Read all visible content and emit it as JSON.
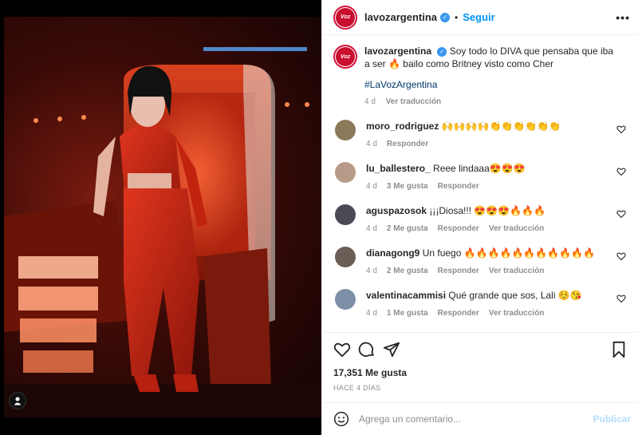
{
  "post": {
    "username": "lavozargentina",
    "avatar_text": "Voz",
    "follow_label": "Seguir",
    "more_label": "•••",
    "caption_text": "Soy todo lo DIVA que pensaba que iba a ser 🔥 bailo como Britney visto como Cher",
    "hashtag": "#LaVozArgentina",
    "caption_time": "4 d",
    "caption_translate": "Ver traducción",
    "likes": "17,351 Me gusta",
    "time_ago": "HACE 4 DÍAS"
  },
  "comments": [
    {
      "user": "moro_rodriguez",
      "text": "🙌🙌🙌🙌👏👏👏👏👏👏",
      "time": "4 d",
      "likes": "",
      "reply": "Responder",
      "translate": "",
      "avatar_color": "#8a7a5a"
    },
    {
      "user": "lu_ballestero_",
      "text": "Reee lindaaa😍😍😍",
      "time": "4 d",
      "likes": "3 Me gusta",
      "reply": "Responder",
      "translate": "",
      "avatar_color": "#b89a88"
    },
    {
      "user": "aguspazosok",
      "text": "¡¡¡Diosa!!! 😍😍😍🔥🔥🔥",
      "time": "4 d",
      "likes": "2 Me gusta",
      "reply": "Responder",
      "translate": "Ver traducción",
      "avatar_color": "#4a4a55"
    },
    {
      "user": "dianagong9",
      "text": "Un fuego 🔥🔥🔥🔥🔥🔥🔥🔥🔥🔥🔥",
      "time": "4 d",
      "likes": "2 Me gusta",
      "reply": "Responder",
      "translate": "Ver traducción",
      "avatar_color": "#6a5e56"
    },
    {
      "user": "valentinacammisi",
      "text": "Qué grande que sos, Lali ☺️😘",
      "time": "4 d",
      "likes": "1 Me gusta",
      "reply": "Responder",
      "translate": "Ver traducción",
      "avatar_color": "#7c8fa6"
    }
  ],
  "add_comment": {
    "placeholder": "Agrega un comentario...",
    "publish_label": "Publicar"
  },
  "colors": {
    "link_blue": "#0095f6",
    "brand_red": "#c8102e",
    "muted": "#8e8e8e"
  },
  "icons": [
    "heart-icon",
    "comment-icon",
    "share-icon",
    "bookmark-icon",
    "emoji-icon",
    "verified-icon",
    "user-tag-icon"
  ]
}
